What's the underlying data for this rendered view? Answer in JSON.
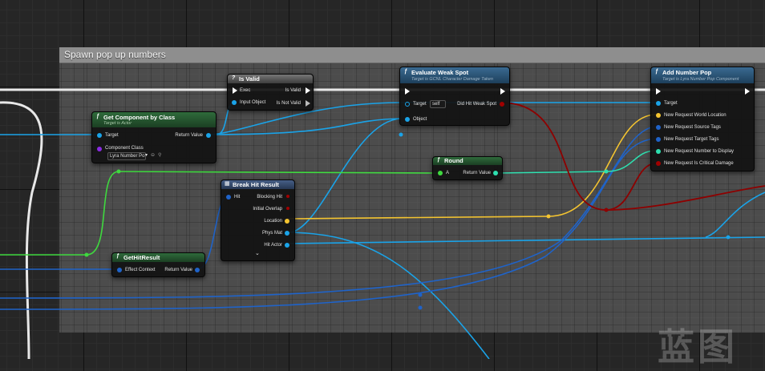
{
  "comment": {
    "title": "Spawn pop up numbers"
  },
  "colors": {
    "exec": "#ffffff",
    "object": "#1aa3e8",
    "struct": "#1f63c9",
    "vector": "#f4c430",
    "float": "#2ee0b0",
    "bool": "#a00000",
    "int": "#3fd93f",
    "class": "#8a2be2"
  },
  "nodes": {
    "is_valid": {
      "title": "Is Valid",
      "icon": "question-icon",
      "pins": {
        "exec": "Exec",
        "input_object": "Input Object",
        "is_valid": "Is Valid",
        "is_not_valid": "Is Not Valid"
      }
    },
    "evaluate_weak_spot": {
      "title": "Evaluate Weak Spot",
      "subtitle": "Target is GCNL Character Damage Taken",
      "icon": "function-icon",
      "pins": {
        "target": "Target",
        "target_value": "self",
        "object": "Object",
        "did_hit": "Did Hit Weak Spot"
      }
    },
    "add_number_pop": {
      "title": "Add Number Pop",
      "subtitle": "Target is Lyra Number Pop Component",
      "icon": "function-icon",
      "pins": {
        "target": "Target",
        "world_location": "New Request World Location",
        "source_tags": "New Request Source Tags",
        "target_tags": "New Request Target Tags",
        "number": "New Request Number to Display",
        "critical": "New Request Is Critical Damage"
      }
    },
    "get_component": {
      "title": "Get Component by Class",
      "subtitle": "Target is Actor",
      "icon": "function-icon",
      "pins": {
        "target": "Target",
        "return_value": "Return Value",
        "component_class": "Component Class",
        "class_value": "Lyra Number Po"
      }
    },
    "round": {
      "title": "Round",
      "icon": "function-icon",
      "pins": {
        "a": "A",
        "return_value": "Return Value"
      }
    },
    "break_hit": {
      "title": "Break Hit Result",
      "icon": "struct-icon",
      "pins": {
        "hit": "Hit",
        "blocking_hit": "Blocking Hit",
        "initial_overlap": "Initial Overlap",
        "location": "Location",
        "phys_mat": "Phys Mat",
        "hit_actor": "Hit Actor"
      }
    },
    "get_hit_result": {
      "title": "GetHitResult",
      "icon": "function-icon",
      "pins": {
        "effect_context": "Effect Context",
        "return_value": "Return Value"
      }
    }
  },
  "watermark": "蓝图"
}
